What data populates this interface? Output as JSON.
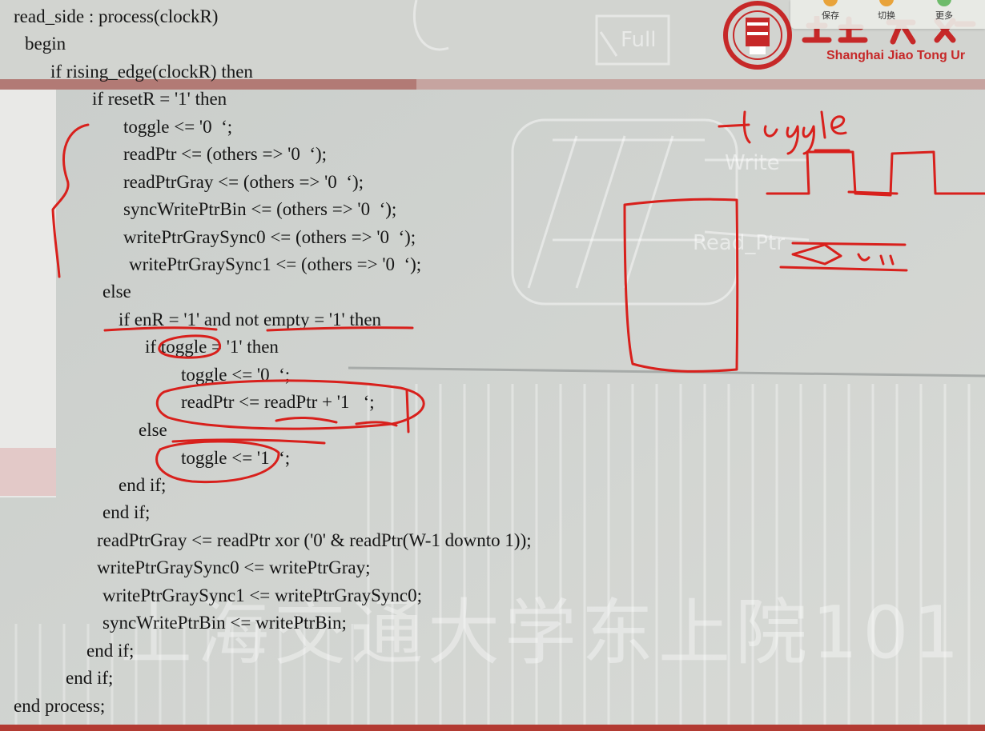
{
  "toolbar": {
    "save_label": "保存",
    "switch_label": "切换",
    "more_label": "更多",
    "save_color": "#e8a33a",
    "switch_color": "#e8a33a",
    "more_color": "#6dbb6a"
  },
  "logo": {
    "name": "Shanghai Jiao Tong Ur",
    "icon": "sjtu-seal-icon",
    "color": "#c62828"
  },
  "watermark": "上海交通大学东上院101",
  "annotation": {
    "handwritten": "toggle",
    "ink_color": "#d8201c"
  },
  "code": {
    "lines": [
      "read_side : process(clockR)",
      "begin",
      "if rising_edge(clockR) then",
      "if resetR = '1' then",
      "toggle <= '0  ‘;",
      "readPtr <= (others => '0  ‘);",
      "readPtrGray <= (others => '0  ‘);",
      "syncWritePtrBin <= (others => '0  ‘);",
      "writePtrGraySync0 <= (others => '0  ‘);",
      "writePtrGraySync1 <= (others => '0  ‘);",
      "else",
      "if enR = '1' and not empty = '1' then",
      "if toggle = '1' then",
      "toggle <= '0  ‘;",
      "readPtr <= readPtr + '1   ‘;",
      "else",
      "toggle <= '1  ‘;",
      "end if;",
      "end if;",
      "readPtrGray <= readPtr xor ('0' & readPtr(W-1 downto 1));",
      "writePtrGraySync0 <= writePtrGray;",
      "writePtrGraySync1 <= writePtrGraySync0;",
      "syncWritePtrBin <= writePtrBin;",
      "end if;",
      "end if;",
      "end process;"
    ]
  }
}
